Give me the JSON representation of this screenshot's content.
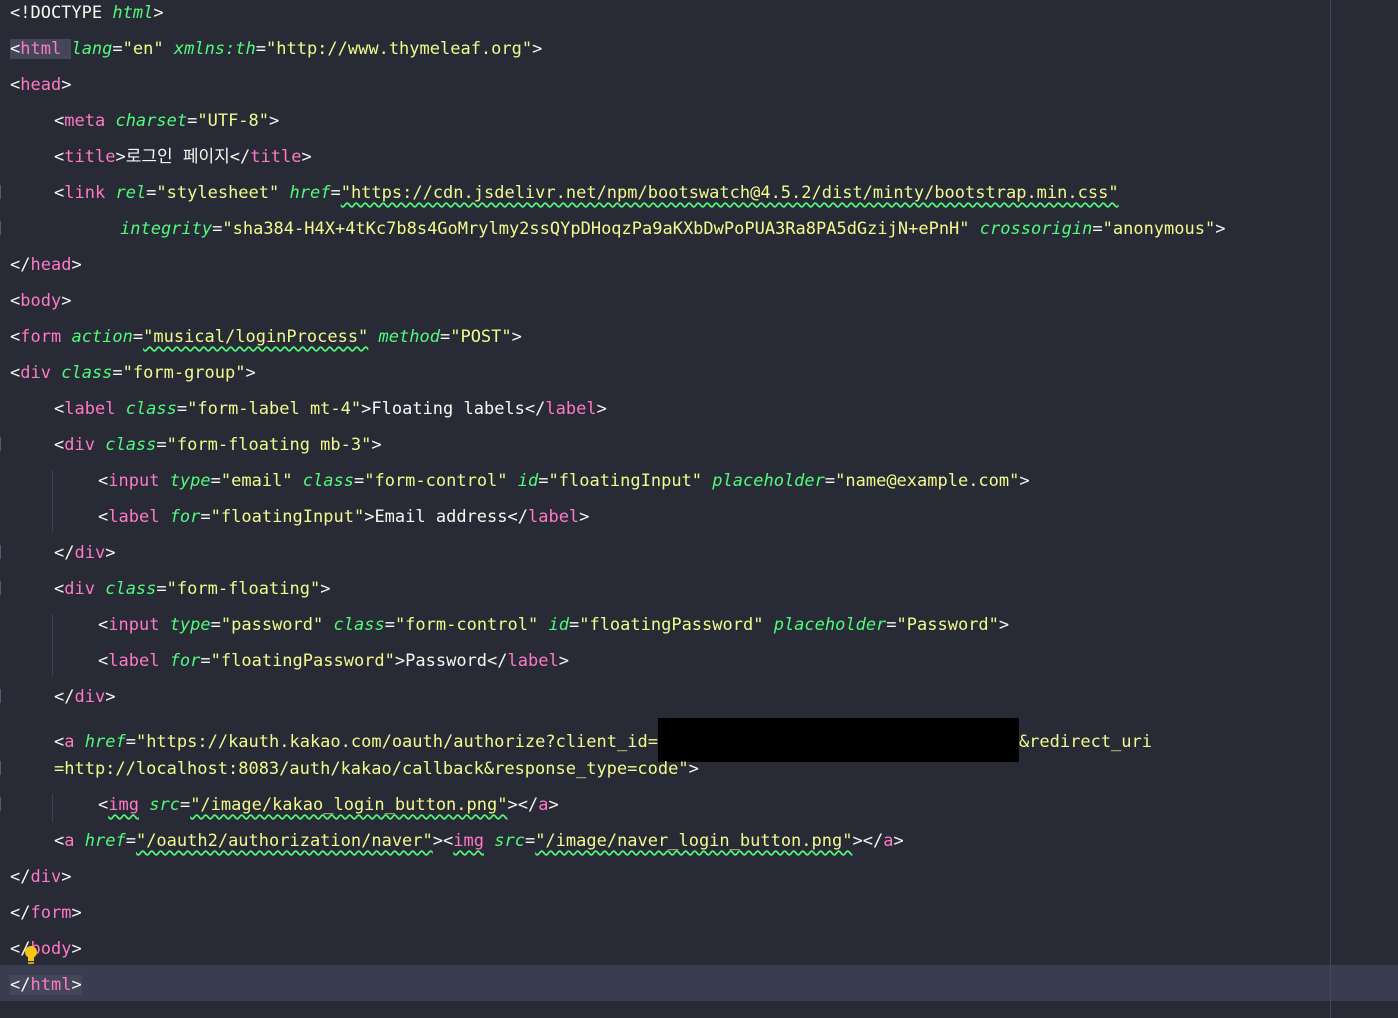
{
  "editor": {
    "theme_colors": {
      "background": "#282a36",
      "tag": "#ff79c6",
      "attribute": "#50fa7b",
      "value": "#f1fa8c",
      "text": "#f8f8f2"
    },
    "lines": {
      "l1": {
        "doctype": "<!DOCTYPE ",
        "doctype_name": "html"
      },
      "l2": {
        "tag": "html",
        "a1": "lang",
        "v1": "\"en\"",
        "a2": "xmlns:th",
        "v2": "\"http://www.thymeleaf.org\""
      },
      "l3": {
        "tag": "head"
      },
      "l4": {
        "tag": "meta",
        "a1": "charset",
        "v1": "\"UTF-8\""
      },
      "l5": {
        "tag": "title",
        "text": "로그인 페이지"
      },
      "l6": {
        "tag": "link",
        "a1": "rel",
        "v1": "\"stylesheet\"",
        "a2": "href",
        "v2": "\"https://cdn.jsdelivr.net/npm/bootswatch@4.5.2/dist/minty/bootstrap.min.css\""
      },
      "l7": {
        "a1": "integrity",
        "v1": "\"sha384-H4X+4tKc7b8s4GoMrylmy2ssQYpDHoqzPa9aKXbDwPoPUA3Ra8PA5dGzijN+ePnH\"",
        "a2": "crossorigin",
        "v2": "\"anonymous\""
      },
      "l8": {
        "tag": "head"
      },
      "l9": {
        "tag": "body"
      },
      "l10": {
        "tag": "form",
        "a1": "action",
        "v1": "\"musical/loginProcess\"",
        "a2": "method",
        "v2": "\"POST\""
      },
      "l11": {
        "tag": "div",
        "a1": "class",
        "v1": "\"form-group\""
      },
      "l12": {
        "tag": "label",
        "a1": "class",
        "v1": "\"form-label mt-4\"",
        "text": "Floating labels"
      },
      "l13": {
        "tag": "div",
        "a1": "class",
        "v1": "\"form-floating mb-3\""
      },
      "l14": {
        "tag": "input",
        "a1": "type",
        "v1": "\"email\"",
        "a2": "class",
        "v2": "\"form-control\"",
        "a3": "id",
        "v3": "\"floatingInput\"",
        "a4": "placeholder",
        "v4": "\"name@example.com\""
      },
      "l15": {
        "tag": "label",
        "a1": "for",
        "v1": "\"floatingInput\"",
        "text": "Email address"
      },
      "l16": {
        "tag": "div"
      },
      "l17": {
        "tag": "div",
        "a1": "class",
        "v1": "\"form-floating\""
      },
      "l18": {
        "tag": "input",
        "a1": "type",
        "v1": "\"password\"",
        "a2": "class",
        "v2": "\"form-control\"",
        "a3": "id",
        "v3": "\"floatingPassword\"",
        "a4": "placeholder",
        "v4": "\"Password\""
      },
      "l19": {
        "tag": "label",
        "a1": "for",
        "v1": "\"floatingPassword\"",
        "text": "Password"
      },
      "l20": {
        "tag": "div"
      },
      "l21": {
        "tag": "a",
        "a1": "href",
        "v1": "\"https://kauth.kakao.com/oauth/authorize?client_id=",
        "v1b": "&redirect_uri"
      },
      "l22": {
        "text": "=http://localhost:8083/auth/kakao/callback&response_type=code\""
      },
      "l23": {
        "tag": "img",
        "a1": "src",
        "v1": "\"/image/kakao_login_button.png\"",
        "tag2": "a"
      },
      "l24": {
        "tag": "a",
        "a1": "href",
        "v1": "\"/oauth2/authorization/naver\"",
        "tag2": "img",
        "a2": "src",
        "v2": "\"/image/naver_login_button.png\"",
        "tag3": "a"
      },
      "l25": {
        "tag": "div"
      },
      "l26": {
        "tag": "form"
      },
      "l27": {
        "tag": "body"
      },
      "l28": {
        "tag": "html"
      }
    }
  }
}
